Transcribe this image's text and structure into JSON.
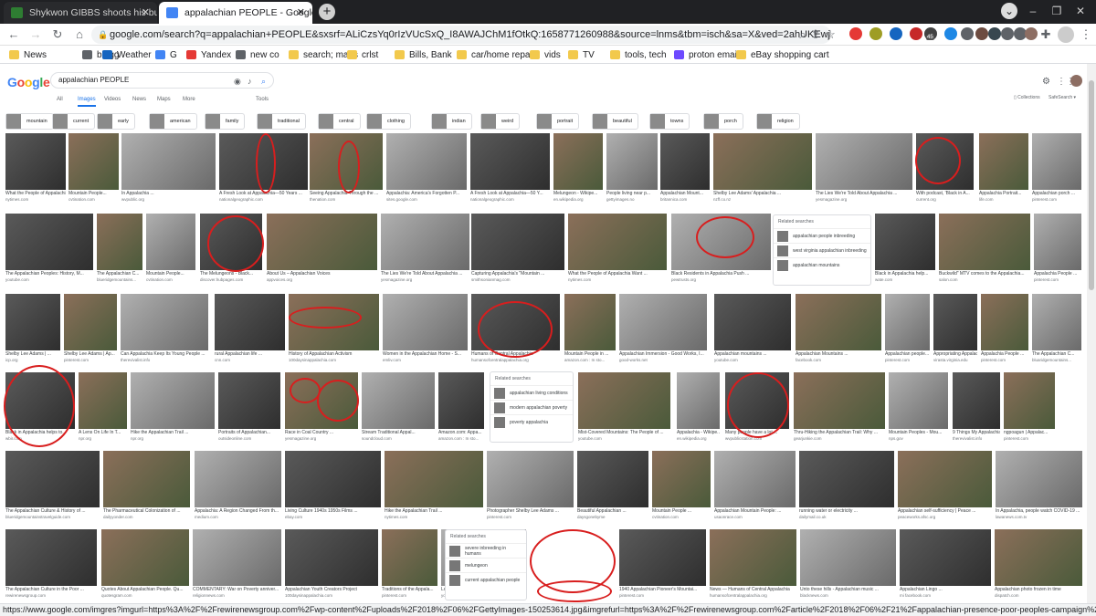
{
  "tabs": [
    {
      "title": "Shykwon GIBBS shoots his burne",
      "favicon_color": "#2e7d32",
      "active": false
    },
    {
      "title": "appalachian PEOPLE - Google Se",
      "favicon_color": "#4285f4",
      "active": true
    }
  ],
  "newtab_label": "+",
  "address": "google.com/search?q=appalachian+PEOPLE&sxsrf=ALiCzsYq0rIzVUcSxQ_I8AWAJChM1fOtkQ:1658771260988&source=lnms&tbm=isch&sa=X&ved=2ahUKEwjG5Zi-z...",
  "nav": {
    "back": "←",
    "forward": "→",
    "reload": "↻",
    "share": "⇪",
    "star": "☆"
  },
  "extensions": [
    {
      "color": "#e53935",
      "badge": ""
    },
    {
      "color": "#9e9d24",
      "badge": ""
    },
    {
      "color": "#1565c0",
      "badge": ""
    },
    {
      "color": "#c62828",
      "badge": ""
    },
    {
      "color": "#424242",
      "badge": "45"
    },
    {
      "color": "#1e88e5",
      "badge": ""
    },
    {
      "color": "#5f6368",
      "badge": ""
    },
    {
      "color": "#6d4c41",
      "badge": ""
    },
    {
      "color": "#37474f",
      "badge": ""
    },
    {
      "color": "#5f6368",
      "badge": ""
    },
    {
      "color": "#5f6368",
      "badge": ""
    },
    {
      "color": "#8d6e63",
      "badge": ""
    }
  ],
  "bookmarks": [
    {
      "label": "News",
      "icon": "folder"
    },
    {
      "label": "blogg",
      "icon": "globe"
    },
    {
      "label": "Weather",
      "icon": "weather"
    },
    {
      "label": "G",
      "icon": "google"
    },
    {
      "label": "Yandex",
      "icon": "yandex"
    },
    {
      "label": "new co",
      "icon": "globe"
    },
    {
      "label": "search; maps",
      "icon": "folder"
    },
    {
      "label": "crlst",
      "icon": "folder"
    },
    {
      "label": "Bills, Bank",
      "icon": "folder"
    },
    {
      "label": "car/home repair",
      "icon": "folder"
    },
    {
      "label": "vids",
      "icon": "folder"
    },
    {
      "label": "TV",
      "icon": "folder"
    },
    {
      "label": "tools, tech",
      "icon": "folder"
    },
    {
      "label": "proton email",
      "icon": "proton"
    },
    {
      "label": "eBay shopping cart",
      "icon": "folder"
    }
  ],
  "google": {
    "logo": "Google",
    "query": "appalachian PEOPLE",
    "tabs": [
      "All",
      "Images",
      "Videos",
      "News",
      "Maps",
      "More"
    ],
    "tools": "Tools",
    "collections": "Collections",
    "safesearch": "SafeSearch"
  },
  "chips": [
    "mountain",
    "current",
    "early",
    "american",
    "family",
    "traditional",
    "central",
    "clothing",
    "indian",
    "weird",
    "portrait",
    "beautiful",
    "towns",
    "porch",
    "religion"
  ],
  "rows": [
    [
      {
        "cap": "What the People of Appalachia...",
        "src": "nytimes.com"
      },
      {
        "cap": "Mountain People...",
        "src": "cvtination.com"
      },
      {
        "cap": "In Appalachia ...",
        "src": "wvpublic.org"
      },
      {
        "cap": "A Fresh Look at Appalachia—50 Years ...",
        "src": "nationalgeographic.com"
      },
      {
        "cap": "Seeing Appalachia Through the ...",
        "src": "thenation.com"
      },
      {
        "cap": "Appalachia: America's Forgotten P...",
        "src": "sites.google.com"
      },
      {
        "cap": "A Fresh Look at Appalachia—50 Y...",
        "src": "nationalgeographic.com"
      },
      {
        "cap": "Melungeon - Wikipe...",
        "src": "en.wikipedia.org"
      },
      {
        "cap": "People living near p...",
        "src": "gettyimages.no"
      },
      {
        "cap": "Appalachian Mount...",
        "src": "britannica.com"
      },
      {
        "cap": "Shelby Lee Adams' Appalachia ...",
        "src": "nzff.co.nz"
      },
      {
        "cap": "The Lies We're Told About Appalachia ...",
        "src": "yesmagazine.org"
      },
      {
        "cap": "With podcast, 'Black in A...",
        "src": "current.org"
      },
      {
        "cap": "Appalachia Portrait...",
        "src": "life.com"
      },
      {
        "cap": "Appalachian porch ...",
        "src": "pinterest.com"
      }
    ],
    [
      {
        "cap": "The Appalachian Peoples: History, M...",
        "src": "youtube.com"
      },
      {
        "cap": "The Appalachian C...",
        "src": "blueridgemountains..."
      },
      {
        "cap": "Mountain People...",
        "src": "cvtination.com"
      },
      {
        "cap": "The Melungeons - Black...",
        "src": "discover.hubpages.com"
      },
      {
        "cap": "About Us – Appalachian Voices",
        "src": "appvoices.org"
      },
      {
        "cap": "The Lies We're Told About Appalachia ...",
        "src": "yesmagazine.org"
      },
      {
        "cap": "Capturing Appalachia's \"Mountain ...",
        "src": "smithsonianmag.com"
      },
      {
        "cap": "What the People of Appalachia Want ...",
        "src": "nytimes.com"
      },
      {
        "cap": "Black Residents in Appalachia Push ...",
        "src": "pewtrusts.org"
      },
      {
        "cap": "Black in Appalachia help...",
        "src": "wate.com"
      },
      {
        "cap": "Buckwild\" MTV comes to the Appalachia...",
        "src": "salon.com"
      },
      {
        "cap": "Appalachia People ...",
        "src": "pinterest.com"
      }
    ],
    [
      {
        "cap": "Shelby Lee Adams | ...",
        "src": "icp.org"
      },
      {
        "cap": "Shelby Lee Adams | Ap...",
        "src": "pinterest.com"
      },
      {
        "cap": "Can Appalachia Keep Its Young People ...",
        "src": "therevivalist.info"
      },
      {
        "cap": "rural Appalachian life ...",
        "src": "cnn.com"
      },
      {
        "cap": "History of Appalachian Activism",
        "src": "100daysinappalachia.com"
      },
      {
        "cap": "Women in the Appalachian Home - S...",
        "src": "emliv.com"
      },
      {
        "cap": "Humans of Central Appalachia",
        "src": "humansofcentralappalachia.org"
      },
      {
        "cap": "Mountain People in ...",
        "src": "amazon.com : In sto..."
      },
      {
        "cap": "Appalachian Immersion - Good Works, I...",
        "src": "good-works.net"
      },
      {
        "cap": "Appalachian mountains ...",
        "src": "youtube.com"
      },
      {
        "cap": "Appalachian Mountains ...",
        "src": "facebook.com"
      },
      {
        "cap": "Appalachian people...",
        "src": "pinterest.com"
      },
      {
        "cap": "Appropriating Appalachia: the ...",
        "src": "virasta.virginia.edu"
      },
      {
        "cap": "Appalachia People ...",
        "src": "pinterest.com"
      },
      {
        "cap": "The Appalachian C...",
        "src": "bluaridgemountains..."
      }
    ],
    [
      {
        "cap": "Black in Appalachia helps to...",
        "src": "wbir.com"
      },
      {
        "cap": "A Lens On Life In T...",
        "src": "npr.org"
      },
      {
        "cap": "Hike the Appalachian Trail ...",
        "src": "npr.org"
      },
      {
        "cap": "Portraits of Appalachian...",
        "src": "outsideonline.com"
      },
      {
        "cap": "Race in Coal Country ...",
        "src": "yesmagazine.org"
      },
      {
        "cap": "Stream Traditional Appal...",
        "src": "soundcloud.com"
      },
      {
        "cap": "Amazon.com: Appa...",
        "src": "amazon.com : In sto..."
      },
      {
        "cap": "Mist-Covered Mountains: The People of ...",
        "src": "youtube.com"
      },
      {
        "cap": "Appalachia - Wikipe...",
        "src": "en.wikipedia.org"
      },
      {
        "cap": "Many people have a lot ...",
        "src": "wvpublicstation.com"
      },
      {
        "cap": "Thru-Hiking the Appalachian Trail: Why ...",
        "src": "gearjunkie.com"
      },
      {
        "cap": "Mountain Peoples - Mou...",
        "src": "nps.gov"
      },
      {
        "cap": "9 Things My Appalachian Daddy ...",
        "src": "therevivalist.info"
      },
      {
        "cap": "ngpoagun | Appalac...",
        "src": "pinterest.com"
      }
    ],
    [
      {
        "cap": "The Appalachian Culture & History of ...",
        "src": "blueridgemountainstravelguide.com"
      },
      {
        "cap": "The Pharmaceutical Colonization of ...",
        "src": "dailyyonder.com"
      },
      {
        "cap": "Appalachia: A Region Changed From th...",
        "src": "medium.com"
      },
      {
        "cap": "Living Culture 1940s 1950s Films ...",
        "src": "ebay.com"
      },
      {
        "cap": "Hike the Appalachian Trail ...",
        "src": "nytimes.com"
      },
      {
        "cap": "Photographer Shelby Lee Adams ...",
        "src": "pinterest.com"
      },
      {
        "cap": "Beautiful Appalachian ...",
        "src": "daysgonebyme"
      },
      {
        "cap": "Mountain People ...",
        "src": "cvtination.com"
      },
      {
        "cap": "Appalachian Mountain People: ...",
        "src": "usaonrace.com"
      },
      {
        "cap": "running water or electricity ...",
        "src": "dailymail.co.uk"
      },
      {
        "cap": "Appalachian self-sufficiency | Peace ...",
        "src": "peaceworks.afsc.org"
      },
      {
        "cap": "In Appalachia, people watch COVID-19 ...",
        "src": "lawanews.com.tv"
      }
    ],
    [
      {
        "cap": "The Appalachian Culture in the Poor ...",
        "src": "rewirenewsgroup.com"
      },
      {
        "cap": "Quotes About Appalachian People. Qu...",
        "src": "quotesgram.com"
      },
      {
        "cap": "COMMENTARY: War on Poverty anniver...",
        "src": "religionnews.com"
      },
      {
        "cap": "Appalachian Youth Creators Project",
        "src": "100daysinappalachia.com"
      },
      {
        "cap": "Traditions of the Appala...",
        "src": "pinterest.com"
      },
      {
        "cap": "Lost Mountain Utopia of Fonta Flor...",
        "src": "youtube.com"
      },
      {
        "cap": "1940 Appalachian Pioneer's Mountai...",
        "src": "pinterest.com"
      },
      {
        "cap": "News — Humans of Central Appalachia",
        "src": "humansofcentralappalachia.org"
      },
      {
        "cap": "Unto these hills - Appalachian music ...",
        "src": "blacknews.com"
      },
      {
        "cap": "Appalachian Lingo ...",
        "src": "mi facebook.com"
      },
      {
        "cap": "Appalachian photo frozen in time",
        "src": "dispatch.com"
      }
    ]
  ],
  "related": [
    {
      "title": "Related searches",
      "items": [
        "appalachian people inbreeding",
        "west virginia appalachian inbreeding",
        "appalachian mountains"
      ]
    },
    {
      "title": "Related searches",
      "items": [
        "appalachian living conditions",
        "modern appalachian poverty",
        "poverty appalachia"
      ]
    },
    {
      "title": "Related searches",
      "items": [
        "severe inbreeding in humans",
        "melungeon",
        "current appalachian people"
      ]
    }
  ],
  "status_url": "https://www.google.com/imgres?imgurl=https%3A%2F%2Frewirenewsgroup.com%2Fwp-content%2Fuploads%2F2018%2F06%2FGettyImages-150253614.jpg&imgrefurl=https%3A%2F%2Frewirenewsgroup.com%2Farticle%2F2018%2F06%2F21%2Fappalachian-presence-poor-peoples-campaign%2F&tbnid=4Voa7..."
}
